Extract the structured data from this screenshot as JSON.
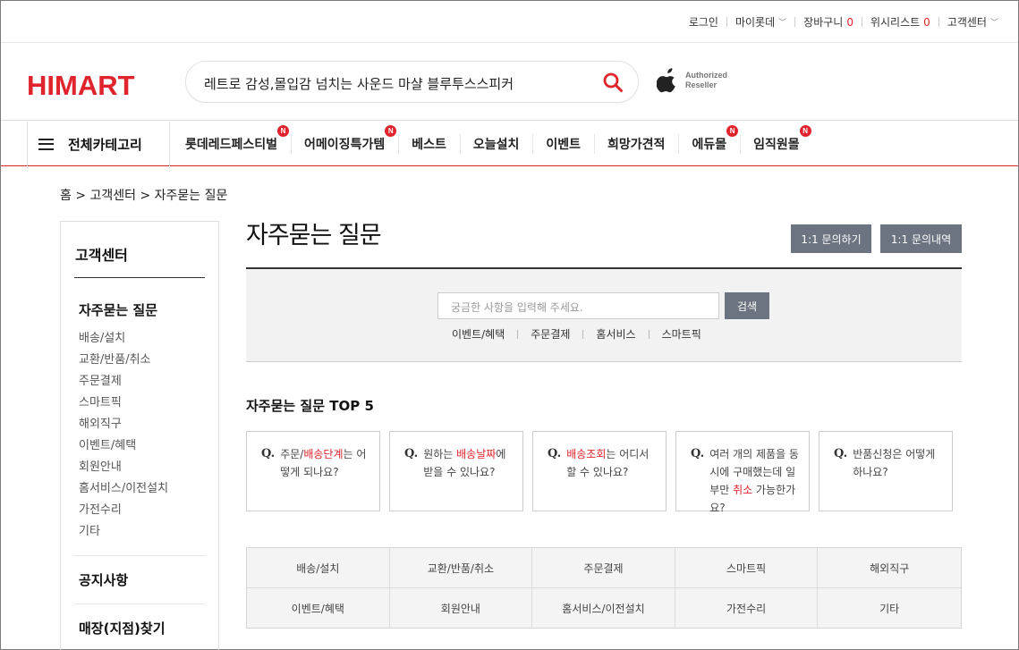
{
  "util": {
    "login": "로그인",
    "mylotte": "마이롯데",
    "cart": "장바구니",
    "cart_count": "0",
    "wishlist": "위시리스트",
    "wishlist_count": "0",
    "cs": "고객센터"
  },
  "header": {
    "logo": "HIMART",
    "search_text": "레트로 감성,몰입감 넘치는 사운드 마샬 블루투스스피커",
    "apple_line1": "Authorized",
    "apple_line2": "Reseller"
  },
  "gnb": {
    "all_categories": "전체카테고리",
    "items": [
      {
        "label": "롯데레드페스티벌",
        "new": "N"
      },
      {
        "label": "어메이징특가템",
        "new": "N"
      },
      {
        "label": "베스트"
      },
      {
        "label": "오늘설치"
      },
      {
        "label": "이벤트"
      },
      {
        "label": "희망가견적"
      },
      {
        "label": "에듀몰",
        "new": "N"
      },
      {
        "label": "임직원몰",
        "new": "N"
      }
    ]
  },
  "breadcrumb": "홈 > 고객센터 > 자주묻는 질문",
  "side": {
    "title": "고객센터",
    "faq": "자주묻는 질문",
    "items": [
      "배송/설치",
      "교환/반품/취소",
      "주문결제",
      "스마트픽",
      "해외직구",
      "이벤트/혜택",
      "회원안내",
      "홈서비스/이전설치",
      "가전수리",
      "기타"
    ],
    "notice": "공지사항",
    "store": "매장(지점)찾기"
  },
  "main": {
    "title": "자주묻는 질문",
    "btn_inquiry": "1:1 문의하기",
    "btn_history": "1:1 문의내역",
    "search_placeholder": "궁금한 사항을 입력해 주세요.",
    "search_button": "검색",
    "keywords": [
      "이벤트/혜택",
      "주문결제",
      "홈서비스",
      "스마트픽"
    ],
    "top5_title": "자주묻는 질문 TOP 5",
    "q_mark": "Q.",
    "top5": [
      {
        "pre": "주문/",
        "hl": "배송단계",
        "post": "는 어떻게 되나요?"
      },
      {
        "pre": "원하는 ",
        "hl": "배송날짜",
        "post": "에 받을 수 있나요?"
      },
      {
        "pre": "",
        "hl": "배송조회",
        "post": "는 어디서 할 수 있나요?"
      },
      {
        "pre": "여러 개의 제품을 동시에 구매했는데 일부만 ",
        "hl": "취소",
        "post": " 가능한가요?"
      },
      {
        "pre": "반품신청은 어떻게 하나요?",
        "hl": "",
        "post": ""
      }
    ],
    "categories": [
      "배송/설치",
      "교환/반품/취소",
      "주문결제",
      "스마트픽",
      "해외직구",
      "이벤트/혜택",
      "회원안내",
      "홈서비스/이전설치",
      "가전수리",
      "기타"
    ]
  },
  "colors": {
    "brand": "#e0242d",
    "button": "#6b7480"
  }
}
